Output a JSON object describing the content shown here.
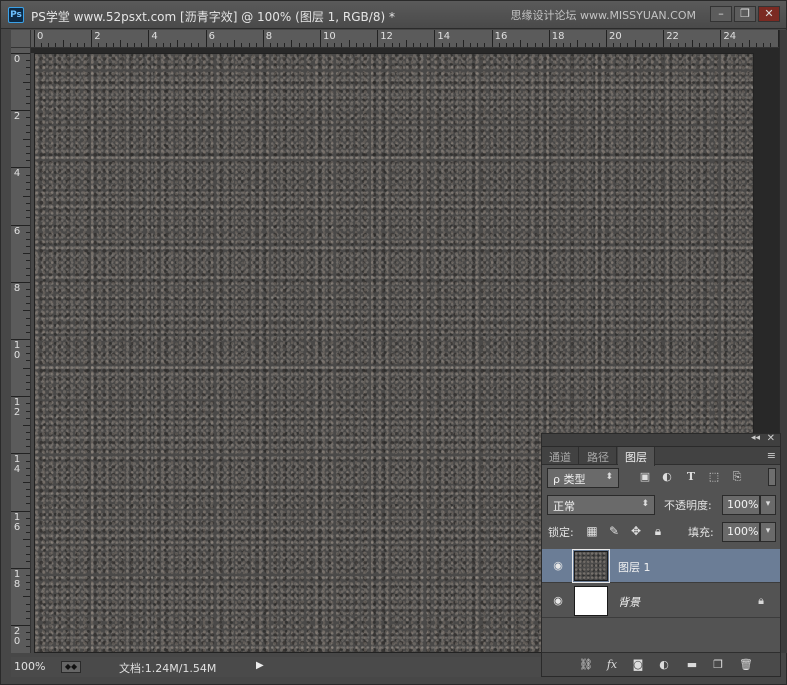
{
  "window": {
    "app_badge": "Ps",
    "title": "PS学堂 www.52psxt.com [沥青字效] @ 100% (图层 1, RGB/8) *",
    "watermark": "思缘设计论坛 www.MISSYUAN.COM",
    "buttons": {
      "minimize": "–",
      "restore": "❐",
      "close": "✕"
    }
  },
  "rulers": {
    "horizontal_labels": [
      "0",
      "2",
      "4",
      "6",
      "8",
      "10",
      "12",
      "14",
      "16",
      "18",
      "20",
      "22",
      "24"
    ],
    "vertical_labels": [
      "0",
      "2",
      "4",
      "6",
      "8",
      "1\n0",
      "1\n2",
      "1\n4",
      "1\n6",
      "1\n8",
      "2\n0"
    ]
  },
  "statusbar": {
    "zoom": "100%",
    "doc_info": "文档:1.24M/1.54M",
    "arrow": "▶"
  },
  "layers_panel": {
    "collapse_icon": "◂◂",
    "close_icon": "✕",
    "tabs": [
      {
        "label": "通道",
        "active": false
      },
      {
        "label": "路径",
        "active": false
      },
      {
        "label": "图层",
        "active": true
      }
    ],
    "menu_icon": "≡",
    "filter": {
      "label": "ρ 类型",
      "icons": [
        "image-filter-icon",
        "adjustment-filter-icon",
        "type-filter-icon",
        "shape-filter-icon",
        "smart-object-filter-icon"
      ]
    },
    "blend_mode": "正常",
    "opacity_label": "不透明度:",
    "opacity_value": "100%",
    "lock_label": "锁定:",
    "fill_label": "填充:",
    "fill_value": "100%",
    "layers": [
      {
        "name": "图层 1",
        "selected": true,
        "italic": false,
        "locked": false
      },
      {
        "name": "背景",
        "selected": false,
        "italic": true,
        "locked": true
      }
    ],
    "footer_icons": [
      "link-layers-icon",
      "fx-icon",
      "add-mask-icon",
      "adjustment-layer-icon",
      "new-group-icon",
      "new-layer-icon",
      "delete-layer-icon"
    ]
  }
}
